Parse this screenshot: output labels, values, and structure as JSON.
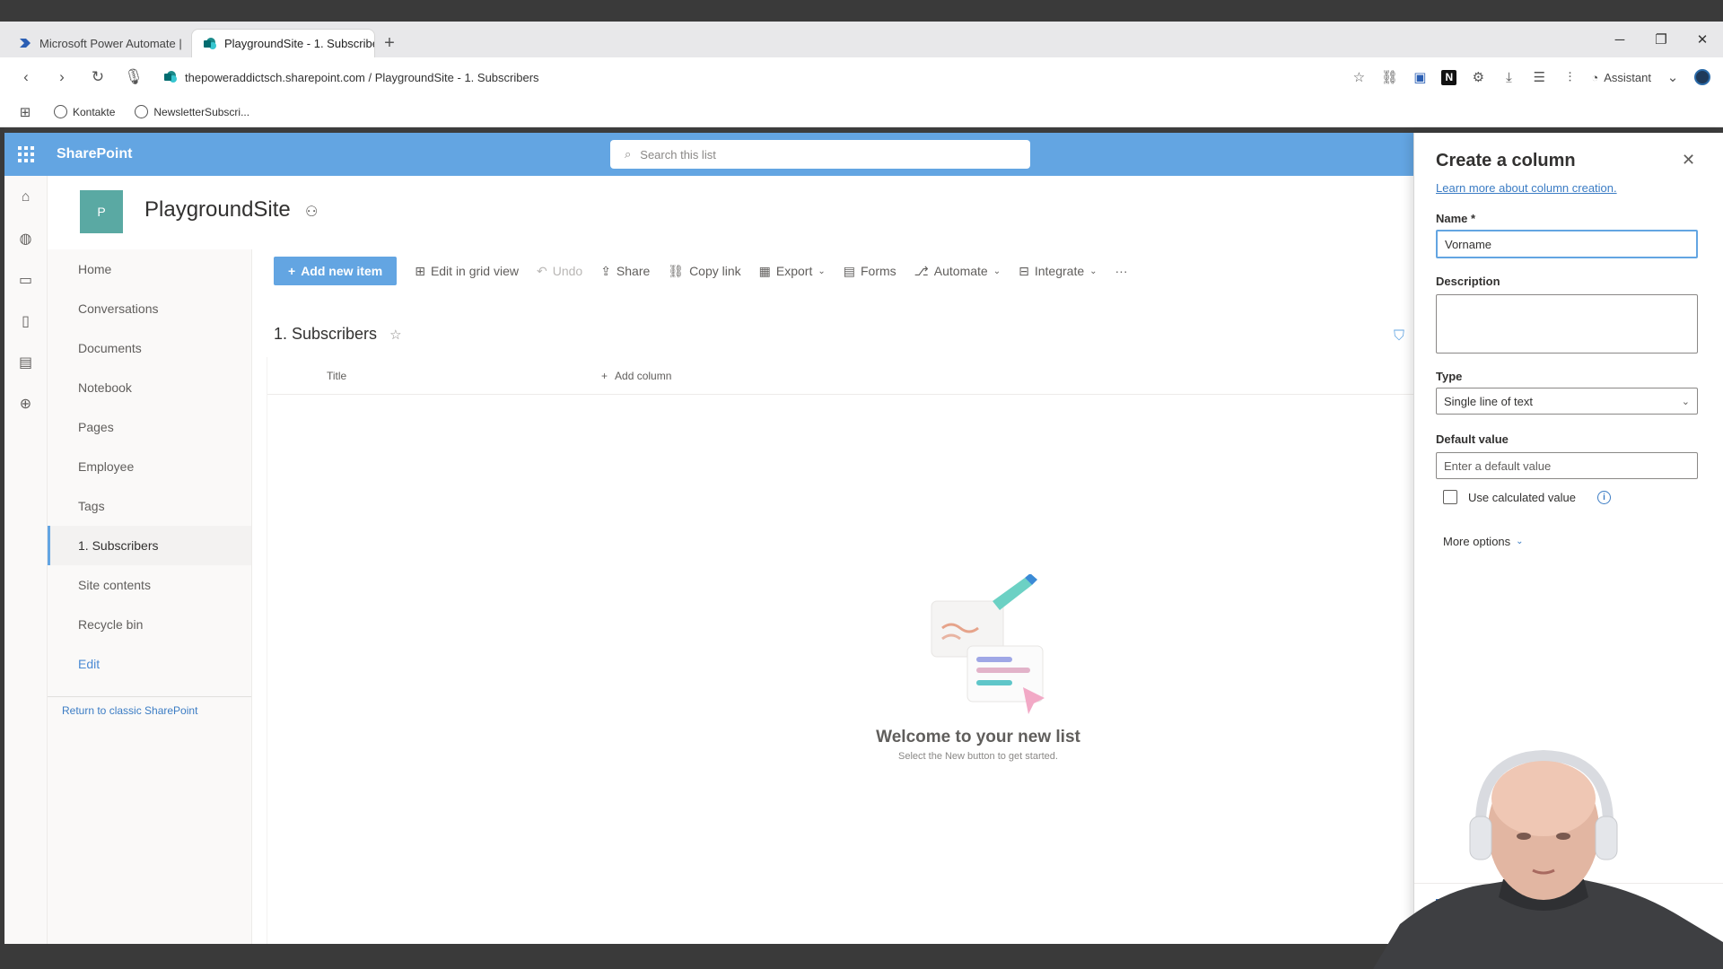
{
  "browser": {
    "tabs": [
      {
        "label": "Microsoft Power Automate | ",
        "active": false,
        "icon": "power-automate-icon"
      },
      {
        "label": "PlaygroundSite - 1. Subscribe",
        "active": true,
        "icon": "sharepoint-icon"
      }
    ],
    "new_tab": "+",
    "url": "thepoweraddictsch.sharepoint.com / PlaygroundSite - 1. Subscribers",
    "assistant_label": "Assistant",
    "bookmarks": [
      {
        "label": "Kontakte"
      },
      {
        "label": "NewsletterSubscri..."
      }
    ]
  },
  "suite": {
    "brand": "SharePoint",
    "search_placeholder": "Search this list",
    "accent": "#63a5e2"
  },
  "site": {
    "logo_letter": "P",
    "logo_color": "#5aa9a3",
    "title": "PlaygroundSite"
  },
  "leftnav": {
    "items": [
      {
        "label": "Home"
      },
      {
        "label": "Conversations"
      },
      {
        "label": "Documents"
      },
      {
        "label": "Notebook"
      },
      {
        "label": "Pages"
      },
      {
        "label": "Employee"
      },
      {
        "label": "Tags"
      },
      {
        "label": "1. Subscribers",
        "selected": true
      },
      {
        "label": "Site contents"
      },
      {
        "label": "Recycle bin"
      },
      {
        "label": "Edit"
      }
    ],
    "classic_link": "Return to classic SharePoint"
  },
  "commandbar": {
    "add_new_item": "Add new item",
    "edit_grid": "Edit in grid view",
    "undo": "Undo",
    "share": "Share",
    "copy_link": "Copy link",
    "export": "Export",
    "forms": "Forms",
    "automate": "Automate",
    "integrate": "Integrate",
    "more": "···"
  },
  "list": {
    "title": "1. Subscribers",
    "columns": {
      "title": "Title",
      "add_column": "Add column"
    },
    "empty_title": "Welcome to your new list",
    "empty_subtitle": "Select the New button to get started."
  },
  "panel": {
    "title": "Create a column",
    "learn_more": "Learn more about column creation.",
    "name_label": "Name *",
    "name_value": "Vorname",
    "description_label": "Description",
    "description_value": "",
    "type_label": "Type",
    "type_value": "Single line of text",
    "default_label": "Default value",
    "default_placeholder": "Enter a default value",
    "use_calculated": "Use calculated value",
    "more_options": "More options"
  }
}
